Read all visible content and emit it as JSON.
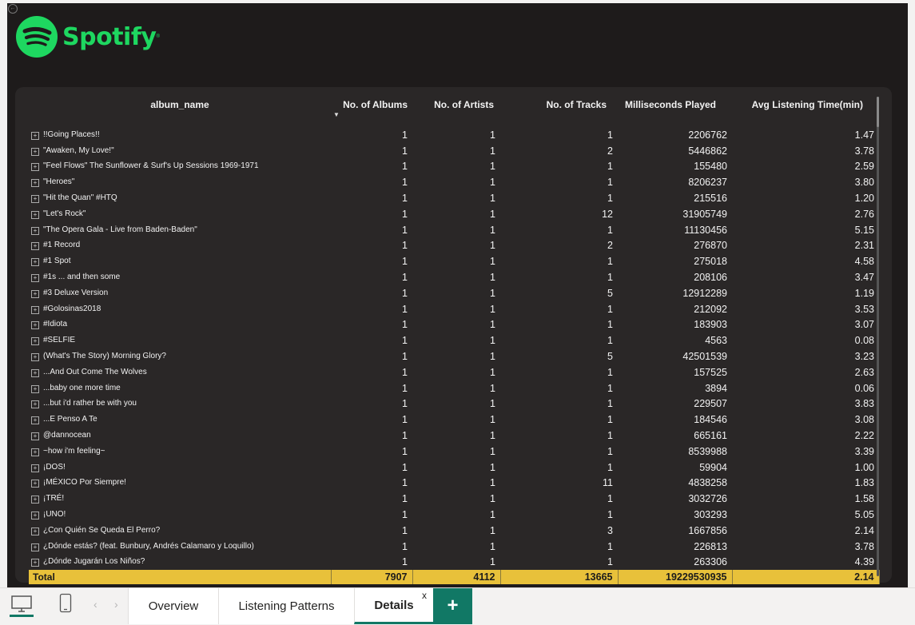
{
  "app": {
    "logo_text": "Spotify",
    "logo_mark": "®",
    "brand_color": "#1ed760",
    "accent_color": "#117865",
    "total_row_color": "#e8c13a"
  },
  "matrix": {
    "columns": [
      "album_name",
      "No. of Albums",
      "No. of Artists",
      "No. of Tracks",
      "Milliseconds Played",
      "Avg Listening Time(min)"
    ],
    "sort_column": "album_name",
    "sort_direction": "descending",
    "rows": [
      [
        "!!Going Places!!",
        "1",
        "1",
        "1",
        "2206762",
        "1.47"
      ],
      [
        "\"Awaken, My Love!\"",
        "1",
        "1",
        "2",
        "5446862",
        "3.78"
      ],
      [
        "\"Feel Flows\" The Sunflower & Surf's Up Sessions 1969-1971",
        "1",
        "1",
        "1",
        "155480",
        "2.59"
      ],
      [
        "\"Heroes\"",
        "1",
        "1",
        "1",
        "8206237",
        "3.80"
      ],
      [
        "\"Hit the Quan\" #HTQ",
        "1",
        "1",
        "1",
        "215516",
        "1.20"
      ],
      [
        "\"Let's Rock\"",
        "1",
        "1",
        "12",
        "31905749",
        "2.76"
      ],
      [
        "\"The Opera Gala - Live from Baden-Baden\"",
        "1",
        "1",
        "1",
        "11130456",
        "5.15"
      ],
      [
        "#1 Record",
        "1",
        "1",
        "2",
        "276870",
        "2.31"
      ],
      [
        "#1 Spot",
        "1",
        "1",
        "1",
        "275018",
        "4.58"
      ],
      [
        "#1s ... and then some",
        "1",
        "1",
        "1",
        "208106",
        "3.47"
      ],
      [
        "#3 Deluxe Version",
        "1",
        "1",
        "5",
        "12912289",
        "1.19"
      ],
      [
        "#Golosinas2018",
        "1",
        "1",
        "1",
        "212092",
        "3.53"
      ],
      [
        "#Idiota",
        "1",
        "1",
        "1",
        "183903",
        "3.07"
      ],
      [
        "#SELFIE",
        "1",
        "1",
        "1",
        "4563",
        "0.08"
      ],
      [
        "(What's The Story) Morning Glory?",
        "1",
        "1",
        "5",
        "42501539",
        "3.23"
      ],
      [
        "...And Out Come The Wolves",
        "1",
        "1",
        "1",
        "157525",
        "2.63"
      ],
      [
        "...baby one more time",
        "1",
        "1",
        "1",
        "3894",
        "0.06"
      ],
      [
        "...but i'd rather be with you",
        "1",
        "1",
        "1",
        "229507",
        "3.83"
      ],
      [
        "...E Penso A Te",
        "1",
        "1",
        "1",
        "184546",
        "3.08"
      ],
      [
        "@dannocean",
        "1",
        "1",
        "1",
        "665161",
        "2.22"
      ],
      [
        "~how i'm feeling~",
        "1",
        "1",
        "1",
        "8539988",
        "3.39"
      ],
      [
        "¡DOS!",
        "1",
        "1",
        "1",
        "59904",
        "1.00"
      ],
      [
        "¡MÉXICO Por Siempre!",
        "1",
        "1",
        "11",
        "4838258",
        "1.83"
      ],
      [
        "¡TRÉ!",
        "1",
        "1",
        "1",
        "3032726",
        "1.58"
      ],
      [
        "¡UNO!",
        "1",
        "1",
        "1",
        "303293",
        "5.05"
      ],
      [
        "¿Con Quién Se Queda El Perro?",
        "1",
        "1",
        "3",
        "1667856",
        "2.14"
      ],
      [
        "¿Dónde estás? (feat. Bunbury, Andrés Calamaro y Loquillo)",
        "1",
        "1",
        "1",
        "226813",
        "3.78"
      ],
      [
        "¿Dónde Jugarán Los Niños?",
        "1",
        "1",
        "1",
        "263306",
        "4.39"
      ]
    ],
    "total": [
      "Total",
      "7907",
      "4112",
      "13665",
      "19229530935",
      "2.14"
    ]
  },
  "bottom_bar": {
    "desktop_icon": "desktop-monitor-icon",
    "phone_icon": "mobile-phone-icon",
    "prev_glyph": "‹",
    "next_glyph": "›",
    "tabs": [
      "Overview",
      "Listening Patterns",
      "Details"
    ],
    "active_tab": "Details",
    "close_glyph": "x",
    "add_glyph": "+"
  }
}
